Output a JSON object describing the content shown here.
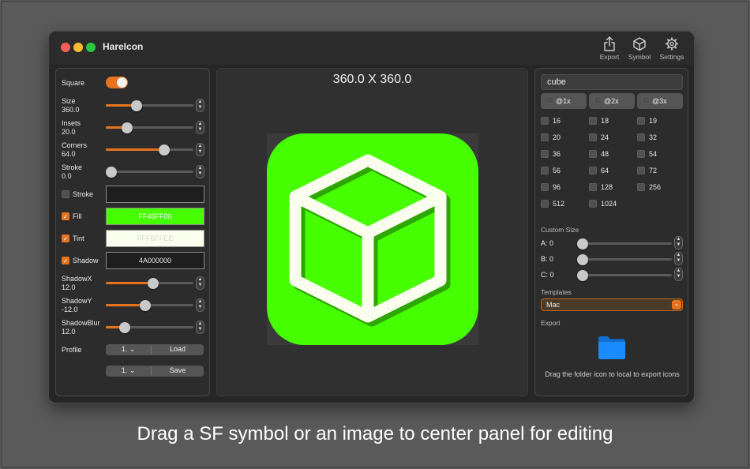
{
  "window": {
    "title": "HareIcon"
  },
  "toolbar": [
    {
      "label": "Export",
      "icon": "share-icon"
    },
    {
      "label": "Symbol",
      "icon": "cube-outline-icon"
    },
    {
      "label": "Settings",
      "icon": "gear-icon"
    }
  ],
  "left": {
    "square_label": "Square",
    "square_on": true,
    "sliders": [
      {
        "label": "Size",
        "value": "360.0",
        "level": 0.33
      },
      {
        "label": "Insets",
        "value": "20.0",
        "level": 0.21
      },
      {
        "label": "Corners",
        "value": "64.0",
        "level": 0.69
      },
      {
        "label": "Stroke",
        "value": "0.0",
        "level": 0.0
      }
    ],
    "colors": [
      {
        "label": "Stroke",
        "checked": false,
        "value": "",
        "bg": "#1e1e1e",
        "fg": "#e6e6e6"
      },
      {
        "label": "Fill",
        "checked": true,
        "value": "FF46FF00",
        "bg": "#46ff00",
        "fg": "#ffffff"
      },
      {
        "label": "Tint",
        "checked": true,
        "value": "FFFBFFEE",
        "bg": "#fbffee",
        "fg": "#d9d9d0"
      },
      {
        "label": "Shadow",
        "checked": true,
        "value": "4A000000",
        "bg": "#1e1e1e",
        "fg": "#e6e6e6"
      }
    ],
    "shadow_sliders": [
      {
        "label": "ShadowX",
        "value": "12.0",
        "level": 0.55
      },
      {
        "label": "ShadowY",
        "value": "-12.0",
        "level": 0.44
      },
      {
        "label": "ShadowBlur",
        "value": "12.0",
        "level": 0.18
      }
    ],
    "profile_label": "Profile",
    "profile_rows": [
      {
        "select": "1.",
        "action": "Load"
      },
      {
        "select": "1.",
        "action": "Save"
      }
    ]
  },
  "center": {
    "dimensions": "360.0 X 360.0",
    "icon_bg": "#46ff00",
    "symbol_color": "#fbffee"
  },
  "right": {
    "search_value": "cube",
    "scales": [
      "@1x",
      "@2x",
      "@3x"
    ],
    "sizes": [
      "16",
      "18",
      "19",
      "20",
      "24",
      "32",
      "36",
      "48",
      "54",
      "56",
      "64",
      "72",
      "96",
      "128",
      "256",
      "512",
      "1024"
    ],
    "custom_size_label": "Custom Size",
    "custom": [
      {
        "label": "A: 0",
        "level": 0
      },
      {
        "label": "B: 0",
        "level": 0
      },
      {
        "label": "C: 0",
        "level": 0
      }
    ],
    "templates_label": "Templates",
    "template_value": "Mac",
    "export_label": "Export",
    "export_hint": "Drag the folder icon to local to export icons",
    "folder_icon": "folder-icon"
  },
  "caption": "Drag a SF symbol or an image to center panel for editing",
  "colors": {
    "accent": "#e8731e",
    "folder": "#1a8cff",
    "window_bg": "#262626",
    "desktop_bg": "#5a5a5a"
  }
}
